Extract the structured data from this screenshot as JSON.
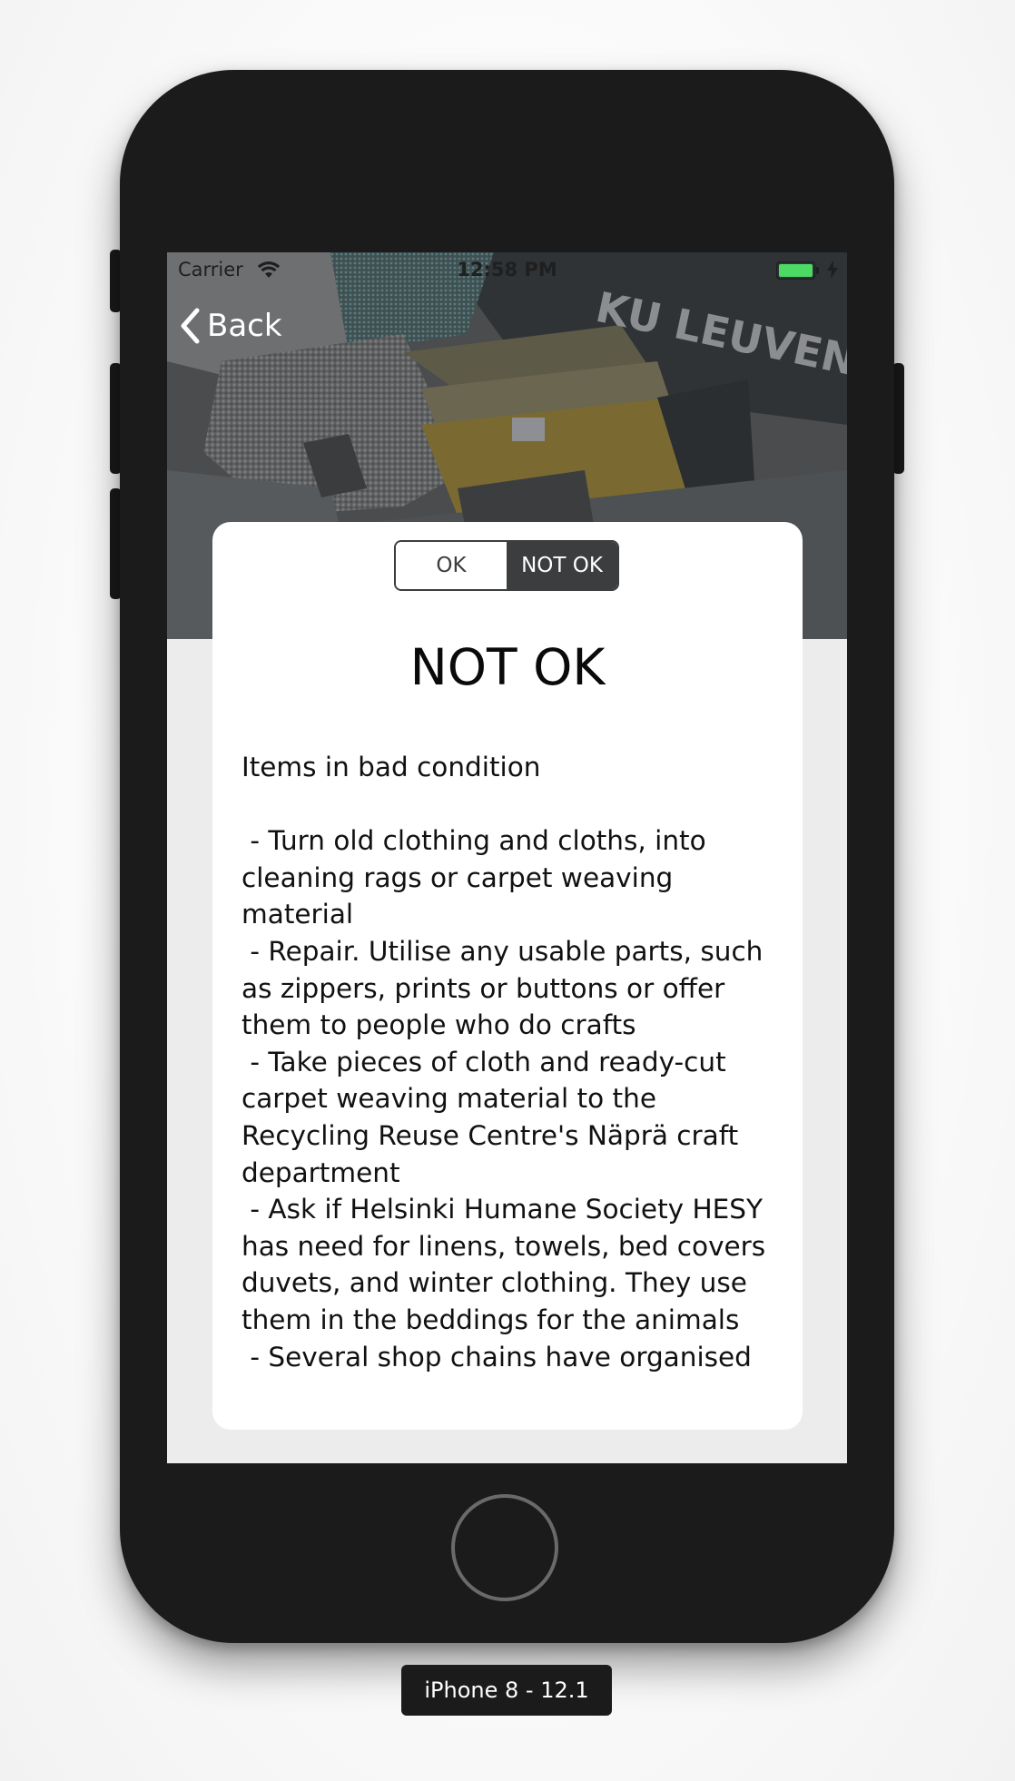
{
  "status_bar": {
    "carrier": "Carrier",
    "time": "12:58 PM"
  },
  "nav": {
    "back_label": "Back"
  },
  "segmented": {
    "options": [
      "OK",
      "NOT OK"
    ],
    "selected": "NOT OK"
  },
  "card": {
    "title": "NOT OK",
    "body": "Items in bad condition\n\n - Turn old clothing and cloths, into cleaning rags or carpet weaving material\n - Repair. Utilise any usable parts, such as zippers, prints or buttons or offer them to people who do crafts\n - Take pieces of cloth and ready-cut carpet weaving material to the Recycling Reuse Centre's Näprä craft department\n - Ask if Helsinki Humane Society HESY has need for linens, towels, bed covers duvets, and winter clothing. They use them in the beddings for the animals\n - Several shop chains have organised"
  },
  "simulator": {
    "device_label": "iPhone 8 - 12.1"
  },
  "hero": {
    "visible_text": "KU LEUVEN"
  },
  "colors": {
    "device_body": "#1b1b1b",
    "screen_background": "#ececec",
    "segment_selected": "#3c3d3f",
    "battery": "#4cd964"
  },
  "icons": [
    "wifi-icon",
    "battery-icon",
    "charging-bolt-icon",
    "chevron-left-icon"
  ]
}
